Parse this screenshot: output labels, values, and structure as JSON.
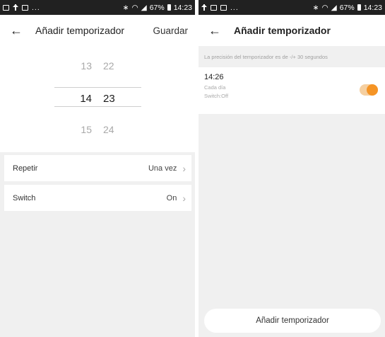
{
  "left": {
    "status": {
      "dots": "...",
      "right": "67%",
      "time": "14:23"
    },
    "header": {
      "title": "Añadir temporizador",
      "save_label": "Guardar"
    },
    "picker": {
      "above": {
        "hour": "13",
        "minute": "22"
      },
      "selected": {
        "hour": "14",
        "minute": "23"
      },
      "below": {
        "hour": "15",
        "minute": "24"
      }
    },
    "settings": [
      {
        "label": "Repetir",
        "value": "Una vez"
      },
      {
        "label": "Switch",
        "value": "On"
      }
    ]
  },
  "right": {
    "status": {
      "dots": "...",
      "right": "67%",
      "time": "14:23"
    },
    "header": {
      "title": "Añadir temporizador"
    },
    "hint": "La precisión del temporizador es de -/+ 30 segundos",
    "timer": {
      "time": "14:26",
      "repeat": "Cada día",
      "switch_state": "Switch:Off",
      "enabled": true
    },
    "add_button": "Añadir temporizador"
  },
  "colors": {
    "accent": "#f59425",
    "toggle_track": "#f5cfa0",
    "background": "#f0f0f0"
  },
  "icons": [
    "back-arrow-icon",
    "chevron-right-icon",
    "bluetooth-icon",
    "wifi-icon",
    "signal-icon",
    "battery-icon"
  ]
}
